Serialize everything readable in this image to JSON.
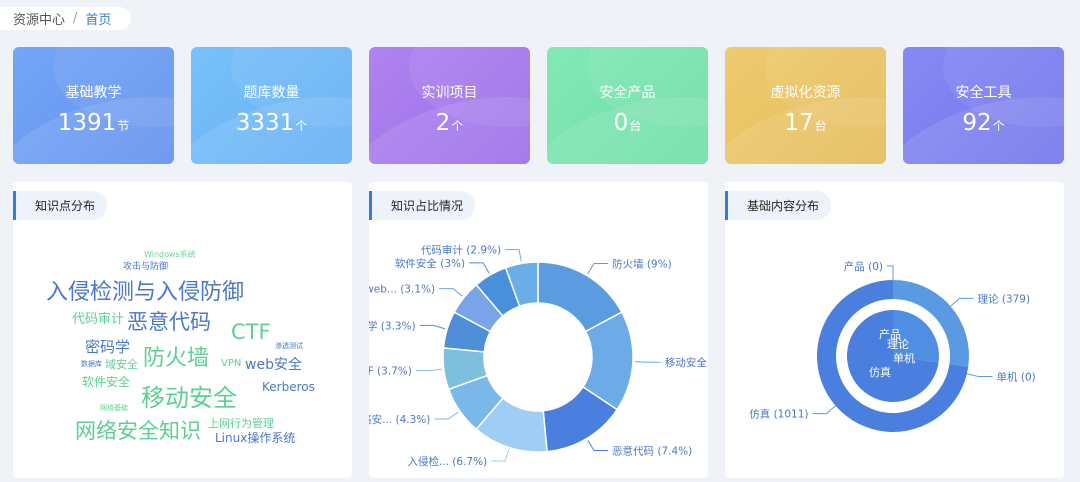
{
  "breadcrumb": {
    "root": "资源中心",
    "separator": "/",
    "current": "首页"
  },
  "cards": [
    {
      "label": "基础教学",
      "value": "1391",
      "unit": "节",
      "color": "#6e9ef4"
    },
    {
      "label": "题库数量",
      "value": "3331",
      "unit": "个",
      "color": "#6db6f7"
    },
    {
      "label": "实训项目",
      "value": "2",
      "unit": "个",
      "color": "#a478ec"
    },
    {
      "label": "安全产品",
      "value": "0",
      "unit": "台",
      "color": "#77e4ad"
    },
    {
      "label": "虚拟化资源",
      "value": "17",
      "unit": "台",
      "color": "#eac465"
    },
    {
      "label": "安全工具",
      "value": "92",
      "unit": "个",
      "color": "#7c7ff0"
    }
  ],
  "panels": {
    "wordcloud_title": "知识点分布",
    "ratio_title": "知识占比情况",
    "content_title": "基础内容分布"
  },
  "wordcloud": [
    {
      "text": "Windows系统",
      "color": "#6fd39a"
    },
    {
      "text": "攻击与防御",
      "color": "#4a78c8"
    },
    {
      "text": "入侵检测与入侵防御",
      "color": "#4a78c8"
    },
    {
      "text": "代码审计",
      "color": "#5dcf95"
    },
    {
      "text": "恶意代码",
      "color": "#4a78c8"
    },
    {
      "text": "CTF",
      "color": "#5dcf95"
    },
    {
      "text": "密码学",
      "color": "#4a78c8"
    },
    {
      "text": "渗透测试",
      "color": "#4a78c8"
    },
    {
      "text": "数据库",
      "color": "#4a78c8"
    },
    {
      "text": "防火墙",
      "color": "#5dcf95"
    },
    {
      "text": "VPN",
      "color": "#5dcf95"
    },
    {
      "text": "web安全",
      "color": "#4a78c8"
    },
    {
      "text": "域安全",
      "color": "#5dcf95"
    },
    {
      "text": "软件安全",
      "color": "#5dcf95"
    },
    {
      "text": "Kerberos",
      "color": "#4a78c8"
    },
    {
      "text": "移动安全",
      "color": "#5dcf95"
    },
    {
      "text": "网络基础",
      "color": "#5dcf95"
    },
    {
      "text": "上网行为管理",
      "color": "#5dcf95"
    },
    {
      "text": "网络安全知识",
      "color": "#5dcf95"
    },
    {
      "text": "Linux操作系统",
      "color": "#4a78c8"
    }
  ],
  "chart_data": [
    {
      "type": "pie",
      "title": "知识占比情况",
      "slices": [
        {
          "label": "防火墙 (9%)",
          "value": 9,
          "color": "#5b9be0"
        },
        {
          "label": "移动安全 (",
          "value": 9,
          "color": "#6cabe8"
        },
        {
          "label": "恶意代码 (7.4%)",
          "value": 7.4,
          "color": "#4a7fe0"
        },
        {
          "label": "入侵检... (6.7%)",
          "value": 6.7,
          "color": "#9fcdf5"
        },
        {
          "label": "络安... (4.3%)",
          "value": 4.3,
          "color": "#7ab7ea"
        },
        {
          "label": "TF (3.7%)",
          "value": 3.7,
          "color": "#7fbfde"
        },
        {
          "label": "学 (3.3%)",
          "value": 3.3,
          "color": "#4f8ed8"
        },
        {
          "label": "web... (3.1%)",
          "value": 3.1,
          "color": "#7aa3e8"
        },
        {
          "label": "软件安全 (3%)",
          "value": 3,
          "color": "#4a8fdc"
        },
        {
          "label": "代码审计 (2.9%)",
          "value": 2.9,
          "color": "#6aaee8"
        }
      ]
    },
    {
      "type": "pie",
      "title": "基础内容分布",
      "outer": [
        {
          "label": "产品 (0)",
          "value": 0,
          "color": "#5b9be0"
        },
        {
          "label": "理论 (379)",
          "value": 379,
          "color": "#5a9ae2"
        },
        {
          "label": "单机 (0)",
          "value": 0,
          "color": "#5b9be0"
        },
        {
          "label": "仿真 (1011)",
          "value": 1011,
          "color": "#4a7fe0"
        }
      ],
      "inner": [
        {
          "label": "产品",
          "value": 0
        },
        {
          "label": "理论",
          "value": 379
        },
        {
          "label": "单机",
          "value": 0
        },
        {
          "label": "仿真",
          "value": 1011
        }
      ]
    }
  ]
}
